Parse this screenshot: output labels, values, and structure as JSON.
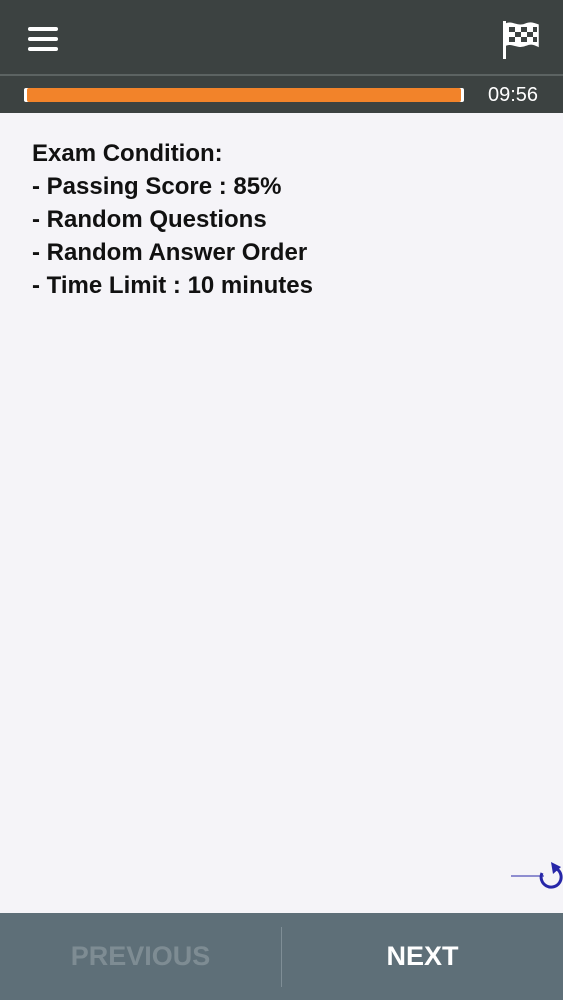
{
  "header": {
    "menu_icon": "hamburger-menu-icon",
    "finish_icon": "checkered-flag-icon"
  },
  "timer": {
    "remaining": "09:56",
    "progress_fraction": 0.993,
    "progress_color": "#f2832a"
  },
  "conditions": {
    "title": "Exam Condition:",
    "items": [
      "- Passing Score : 85%",
      "- Random Questions",
      "- Random Answer Order",
      "- Time Limit : 10 minutes"
    ]
  },
  "refresh_icon": "refresh-icon",
  "navigation": {
    "previous_label": "PREVIOUS",
    "next_label": "NEXT"
  },
  "colors": {
    "app_bar": "#3c4241",
    "bottom_bar": "#5e6f78",
    "accent": "#f2832a",
    "refresh": "#2626a8"
  }
}
